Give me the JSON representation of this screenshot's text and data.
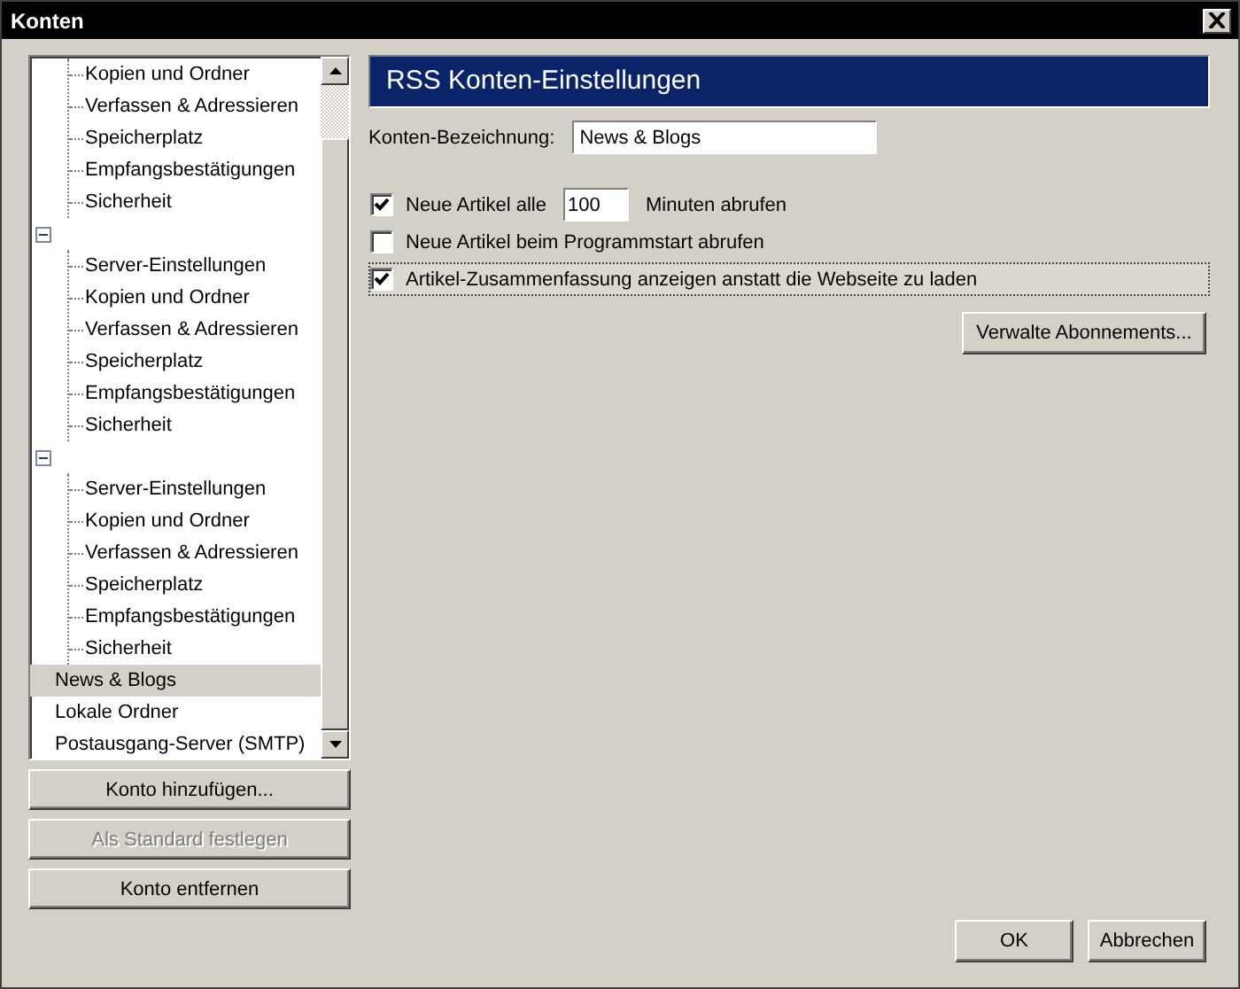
{
  "window": {
    "title": "Konten"
  },
  "tree": [
    {
      "children": [
        {
          "label": "Kopien und Ordner",
          "selected": false
        },
        {
          "label": "Verfassen & Adressieren",
          "selected": false
        },
        {
          "label": "Speicherplatz",
          "selected": false
        },
        {
          "label": "Empfangsbestätigungen",
          "selected": false
        },
        {
          "label": "Sicherheit",
          "selected": false
        }
      ]
    },
    {
      "expanded": true,
      "children": [
        {
          "label": "Server-Einstellungen",
          "selected": false
        },
        {
          "label": "Kopien und Ordner",
          "selected": false
        },
        {
          "label": "Verfassen & Adressieren",
          "selected": false
        },
        {
          "label": "Speicherplatz",
          "selected": false
        },
        {
          "label": "Empfangsbestätigungen",
          "selected": false
        },
        {
          "label": "Sicherheit",
          "selected": false
        }
      ]
    },
    {
      "expanded": true,
      "children": [
        {
          "label": "Server-Einstellungen",
          "selected": false
        },
        {
          "label": "Kopien und Ordner",
          "selected": false
        },
        {
          "label": "Verfassen & Adressieren",
          "selected": false
        },
        {
          "label": "Speicherplatz",
          "selected": false
        },
        {
          "label": "Empfangsbestätigungen",
          "selected": false
        },
        {
          "label": "Sicherheit",
          "selected": false
        }
      ]
    },
    {
      "label": "News & Blogs",
      "selected": true
    },
    {
      "label": "Lokale Ordner",
      "selected": false
    },
    {
      "label": "Postausgang-Server (SMTP)",
      "selected": false
    }
  ],
  "account_buttons": [
    {
      "label": "Konto hinzufügen...",
      "disabled": false
    },
    {
      "label": "Als Standard festlegen",
      "disabled": true
    },
    {
      "label": "Konto entfernen",
      "disabled": false
    }
  ],
  "panel": {
    "title": "RSS Konten-Einstellungen",
    "name_label": "Konten-Bezeichnung:",
    "name_value": "News & Blogs",
    "options": [
      {
        "kind": "interval",
        "label": "Neue Artikel alle",
        "checked": true,
        "focused": false,
        "value": "100",
        "suffix": "Minuten abrufen"
      },
      {
        "kind": "plain",
        "label": "Neue Artikel beim Programmstart abrufen",
        "checked": false,
        "focused": false
      },
      {
        "kind": "plain",
        "label": "Artikel-Zusammenfassung anzeigen anstatt die Webseite zu laden",
        "checked": true,
        "focused": true
      }
    ],
    "manage_button": "Verwalte Abonnements..."
  },
  "dialog_buttons": [
    "OK",
    "Abbrechen"
  ]
}
